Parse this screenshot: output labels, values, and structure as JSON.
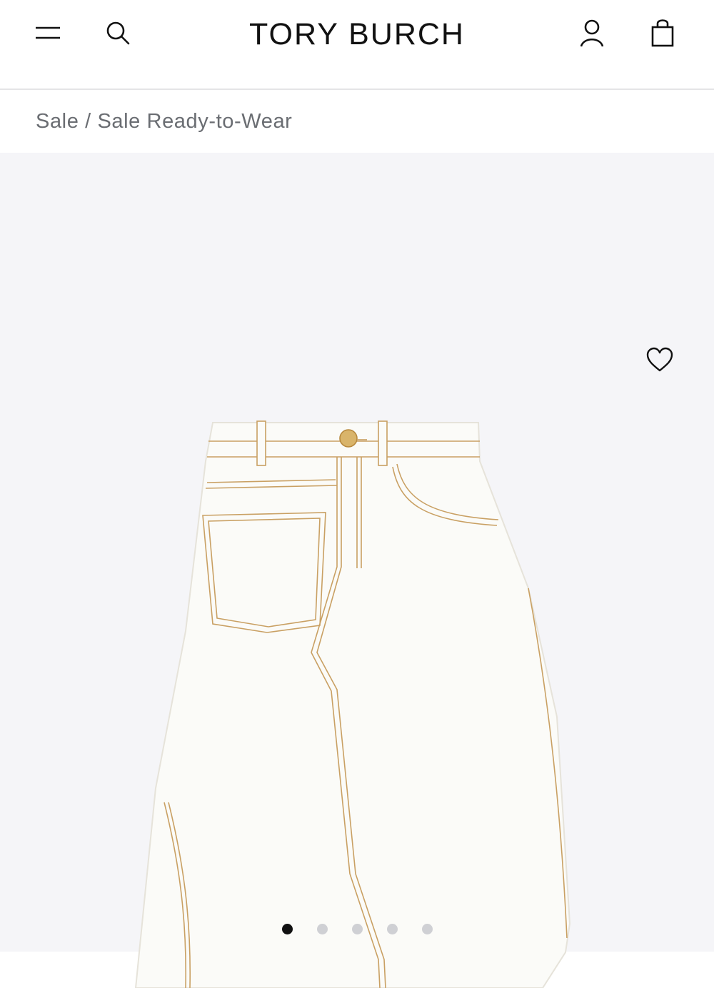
{
  "header": {
    "brand": "TORY BURCH",
    "icons": [
      "menu-icon",
      "search-icon",
      "account-icon",
      "shopping-bag-icon"
    ]
  },
  "breadcrumb": {
    "items": [
      "Sale",
      "Sale Ready-to-Wear"
    ],
    "separator": " / "
  },
  "gallery": {
    "product_image": "white denim A-line midi skirt with gold topstitching",
    "wishlist_icon": "heart-icon",
    "slide_count": 5,
    "active_slide": 1
  },
  "colors": {
    "accent": "#111111",
    "gallery_background": "#f5f5f8",
    "breadcrumb_text": "#6a6d72",
    "stitching": "#c9a063"
  }
}
